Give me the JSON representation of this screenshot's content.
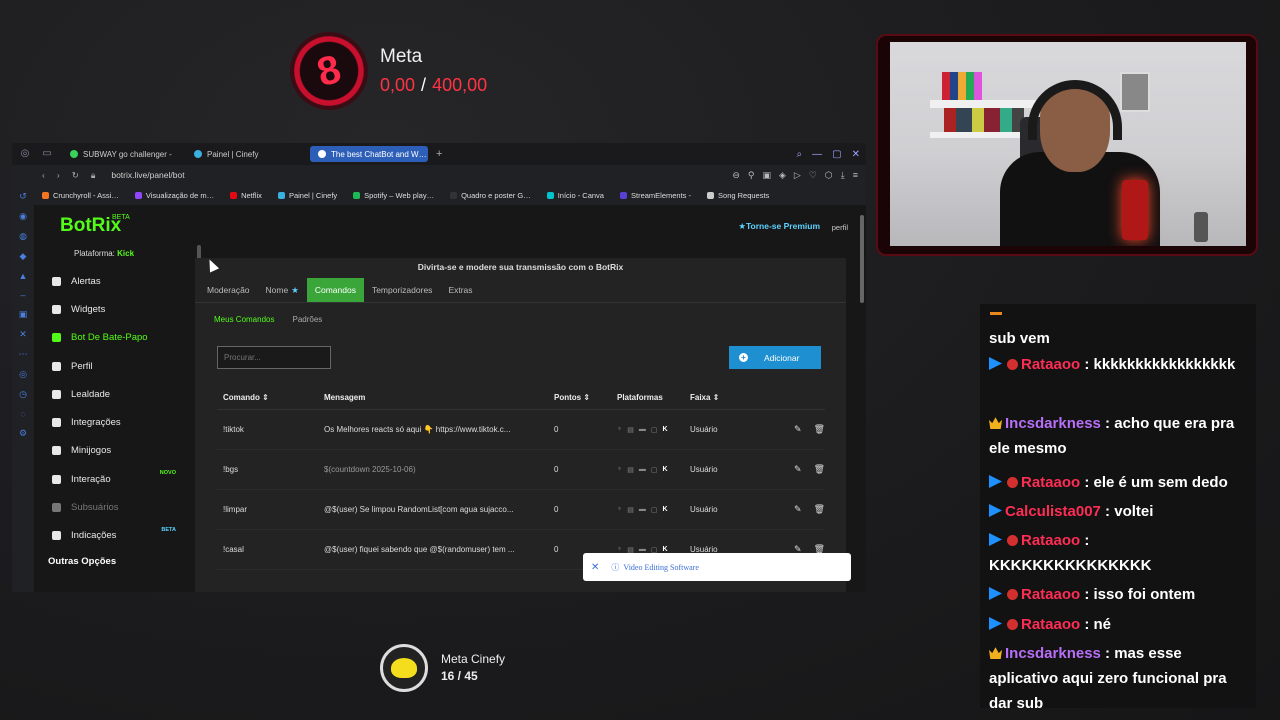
{
  "goal_top": {
    "title": "Meta",
    "current": "0,00",
    "separator": "/",
    "target": "400,00",
    "icon": "ring-logo-icon",
    "accent": "#ff3344"
  },
  "browser": {
    "tabs": [
      {
        "label": "SUBWAY go challenger -",
        "color": "#3ad15a"
      },
      {
        "label": "Painel | Cinefy",
        "color": "#3ab0e0"
      },
      {
        "label": "The best ChatBot and W…",
        "color": "#ffffff"
      }
    ],
    "url": "botrix.live/panel/bot",
    "bookmarks": [
      {
        "label": "Crunchyroll - Assi…",
        "color": "#f47521"
      },
      {
        "label": "Visualização de m…",
        "color": "#9146ff"
      },
      {
        "label": "Netflix",
        "color": "#e50914"
      },
      {
        "label": "Painel | Cinefy",
        "color": "#3ab0e0"
      },
      {
        "label": "Spotify – Web play…",
        "color": "#1db954"
      },
      {
        "label": "Quadro e poster G…",
        "color": "#333333"
      },
      {
        "label": "Início - Canva",
        "color": "#00c4cc"
      },
      {
        "label": "StreamElements -",
        "color": "#5a3fd6"
      },
      {
        "label": "Song Requests",
        "color": "#cccccc"
      }
    ]
  },
  "botrix": {
    "brand": "BotRix",
    "brand_badge": "BETA",
    "platform_label": "Plataforma:",
    "platform_value": "Kick",
    "premium": "★Torne-se Premium",
    "profile": "perfil",
    "nav": [
      {
        "label": "Alertas"
      },
      {
        "label": "Widgets"
      },
      {
        "label": "Bot De Bate-Papo",
        "active": true
      },
      {
        "label": "Perfil"
      },
      {
        "label": "Lealdade"
      },
      {
        "label": "Integrações"
      },
      {
        "label": "Minijogos"
      },
      {
        "label": "Interação",
        "badge": "NOVO"
      },
      {
        "label": "Subsuários",
        "dim": true
      },
      {
        "label": "Indicações",
        "badge": "BETA"
      }
    ],
    "other_options": "Outras Opções",
    "panel_header": "Divirta-se e modere sua transmissão com o BotRix",
    "tabs": [
      "Moderação",
      "Nome",
      "Comandos",
      "Temporizadores",
      "Extras"
    ],
    "active_tab": "Comandos",
    "subtabs": [
      "Meus Comandos",
      "Padrões"
    ],
    "search_placeholder": "Procurar...",
    "add_button": "Adicionar",
    "columns": [
      "Comando",
      "Mensagem",
      "Pontos",
      "Plataformas",
      "Faixa"
    ],
    "rows": [
      {
        "command": "!tiktok",
        "message": "Os Melhores reacts só aqui 👇 https://www.tiktok.c...",
        "points": "0",
        "rank": "Usuário"
      },
      {
        "command": "!bgs",
        "message": "$(countdown 2025-10-06)",
        "points": "0",
        "rank": "Usuário",
        "muted": true
      },
      {
        "command": "!limpar",
        "message": "@$(user) Se limpou RandomList[com agua sujacco...",
        "points": "0",
        "rank": "Usuário"
      },
      {
        "command": "!casal",
        "message": "@$(user) fiquei sabendo que @$(randomuser) tem ...",
        "points": "0",
        "rank": "Usuário"
      }
    ]
  },
  "toast": {
    "text": "Video Editing Software",
    "close": "✕"
  },
  "chat": {
    "messages": [
      {
        "parts": [
          {
            "text": "sub vem",
            "cls": ""
          }
        ],
        "badges": []
      },
      {
        "badges": [
          "prime",
          "dot"
        ],
        "parts": [
          {
            "text": "Rataaoo",
            "cls": "u-red"
          },
          {
            "text": " : kkkkkkkkkkkkkkkkk",
            "cls": ""
          }
        ]
      },
      {
        "badges": [
          "crown"
        ],
        "parts": [
          {
            "text": "Incsdarkness",
            "cls": "u-purple"
          },
          {
            "text": " : acho que era pra ele mesmo",
            "cls": ""
          }
        ]
      },
      {
        "badges": [
          "prime",
          "dot"
        ],
        "parts": [
          {
            "text": "Rataaoo",
            "cls": "u-red"
          },
          {
            "text": " : ele é um sem dedo",
            "cls": ""
          }
        ]
      },
      {
        "badges": [
          "prime"
        ],
        "parts": [
          {
            "text": "Calculista007",
            "cls": "u-red"
          },
          {
            "text": " : voltei",
            "cls": ""
          }
        ]
      },
      {
        "badges": [
          "prime",
          "dot"
        ],
        "parts": [
          {
            "text": "Rataaoo",
            "cls": "u-red"
          },
          {
            "text": " : KKKKKKKKKKKKKKK",
            "cls": ""
          }
        ]
      },
      {
        "badges": [
          "prime",
          "dot"
        ],
        "parts": [
          {
            "text": "Rataaoo",
            "cls": "u-red"
          },
          {
            "text": " : isso foi ontem",
            "cls": ""
          }
        ]
      },
      {
        "badges": [
          "prime",
          "dot"
        ],
        "parts": [
          {
            "text": "Rataaoo",
            "cls": "u-red"
          },
          {
            "text": " : né",
            "cls": ""
          }
        ]
      },
      {
        "badges": [
          "crown"
        ],
        "parts": [
          {
            "text": "Incsdarkness",
            "cls": "u-purple"
          },
          {
            "text": " : mas esse aplicativo aqui zero funcional pra dar sub",
            "cls": ""
          }
        ]
      }
    ]
  },
  "goal_bottom": {
    "title": "Meta Cinefy",
    "value": "16 / 45",
    "icon": "cinefy-logo-icon"
  }
}
